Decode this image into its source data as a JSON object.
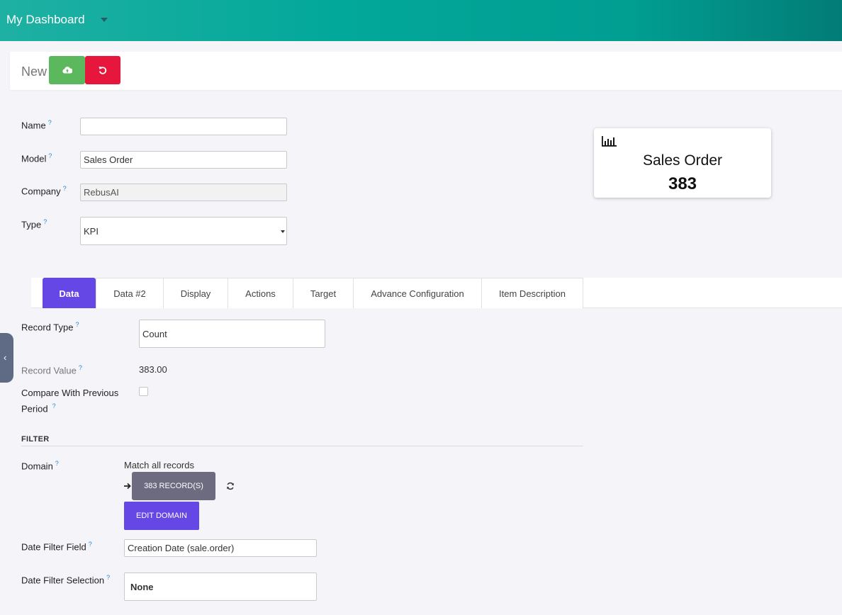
{
  "topbar": {
    "title": "My Dashboard"
  },
  "controlbar": {
    "breadcrumb": "New"
  },
  "form": {
    "name": {
      "label": "Name",
      "help": "?",
      "value": ""
    },
    "model": {
      "label": "Model",
      "help": "?",
      "value": "Sales Order"
    },
    "company": {
      "label": "Company",
      "help": "?",
      "value": "RebusAI"
    },
    "type": {
      "label": "Type",
      "help": "?",
      "value": "KPI"
    }
  },
  "preview": {
    "name": "Sales Order",
    "value": "383",
    "icon": "bar-chart-icon"
  },
  "tabs": [
    {
      "label": "Data"
    },
    {
      "label": "Data #2"
    },
    {
      "label": "Display"
    },
    {
      "label": "Actions"
    },
    {
      "label": "Target"
    },
    {
      "label": "Advance Configuration"
    },
    {
      "label": "Item Description"
    }
  ],
  "data_tab": {
    "record_type": {
      "label": "Record Type",
      "help": "?",
      "value": "Count"
    },
    "record_value": {
      "label": "Record Value",
      "help": "?",
      "value": "383.00"
    },
    "compare": {
      "label_line1": "Compare With Previous",
      "label_line2": "Period",
      "help": "?"
    },
    "filter_title": "FILTER",
    "domain": {
      "label": "Domain",
      "help": "?",
      "match_text": "Match all records",
      "records_button": "383 RECORD(S)",
      "edit_button": "EDIT DOMAIN"
    },
    "date_filter_field": {
      "label": "Date Filter Field",
      "help": "?",
      "value": "Creation Date (sale.order)"
    },
    "date_filter_selection": {
      "label": "Date Filter Selection",
      "help": "?",
      "value": "None"
    }
  },
  "colors": {
    "accent": "#6547e6",
    "save": "#5cb85c",
    "discard": "#e6163c",
    "header": "#02a89a"
  }
}
